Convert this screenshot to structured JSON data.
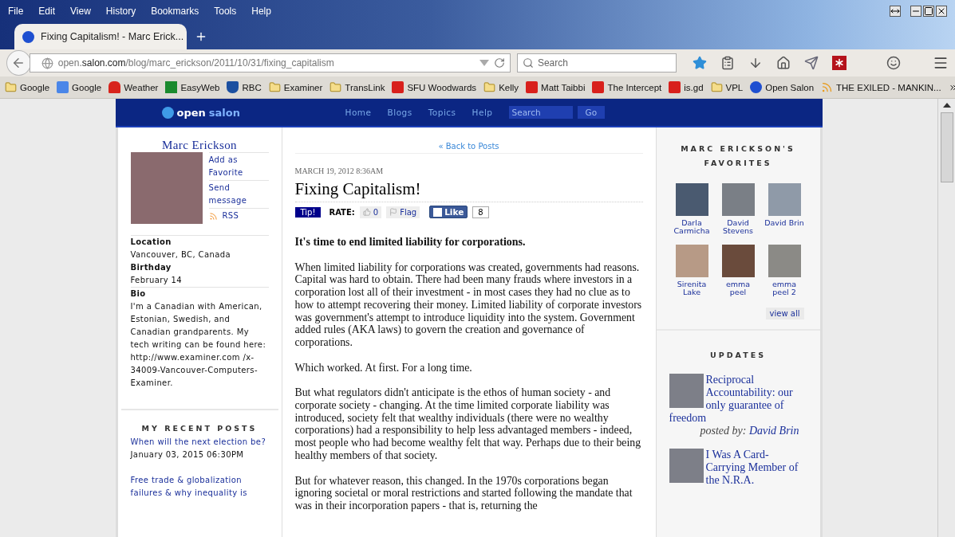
{
  "window": {
    "menu": [
      "File",
      "Edit",
      "View",
      "History",
      "Bookmarks",
      "Tools",
      "Help"
    ]
  },
  "tabs": [
    {
      "title": "Fixing Capitalism! - Marc Erick...",
      "selected": true
    }
  ],
  "address_bar": {
    "host_prefix": "open.",
    "host": "salon.com",
    "path": "/blog/marc_erickson/2011/10/31/fixing_capitalism"
  },
  "search": {
    "placeholder": "Search"
  },
  "bookmarks": [
    {
      "label": "Google",
      "kind": "folder"
    },
    {
      "label": "Google",
      "kind": "google"
    },
    {
      "label": "Weather",
      "kind": "leaf"
    },
    {
      "label": "EasyWeb",
      "kind": "green"
    },
    {
      "label": "RBC",
      "kind": "shield"
    },
    {
      "label": "Examiner",
      "kind": "folder"
    },
    {
      "label": "TransLink",
      "kind": "folder"
    },
    {
      "label": "SFU Woodwards",
      "kind": "red"
    },
    {
      "label": "Kelly",
      "kind": "folder"
    },
    {
      "label": "Matt Taibbi",
      "kind": "red"
    },
    {
      "label": "The Intercept",
      "kind": "red"
    },
    {
      "label": "is.gd",
      "kind": "red"
    },
    {
      "label": "VPL",
      "kind": "folder"
    },
    {
      "label": "Open Salon",
      "kind": "salon"
    },
    {
      "label": "THE EXILED - MANKIN...",
      "kind": "rss"
    }
  ],
  "site": {
    "logo_first": "open",
    "logo_second": "salon",
    "nav": [
      "Home",
      "Blogs",
      "Topics",
      "Help"
    ],
    "search_placeholder": "Search",
    "go": "Go"
  },
  "profile": {
    "name": "Marc Erickson",
    "links": [
      "Add as Favorite",
      "Send message"
    ],
    "rss": "RSS",
    "fields": [
      {
        "label": "Location",
        "value": "Vancouver, BC, Canada"
      },
      {
        "label": "Birthday",
        "value": "February 14"
      },
      {
        "label": "Bio",
        "value": "I'm a Canadian with American, Estonian, Swedish, and Canadian grandparents. My tech writing can be found here: http://www.examiner.com /x-34009-Vancouver-Computers-Examiner."
      }
    ]
  },
  "recent_posts": {
    "title": "MY RECENT POSTS",
    "items": [
      {
        "title": "When will the next election be?",
        "date": "January 03, 2015 06:30PM"
      },
      {
        "title": "Free trade & globalization failures & why inequality is"
      }
    ]
  },
  "article": {
    "back": "« Back to Posts",
    "date": "MARCH 19, 2012 8:36AM",
    "title": "Fixing Capitalism!",
    "tip": "Tip!",
    "rate_label": "RATE:",
    "rate_count": "0",
    "flag": "Flag",
    "like": "Like",
    "like_count": "8",
    "lead": "It's time to end limited liability for corporations.",
    "paragraphs": [
      "When limited liability for corporations was created, governments had reasons.  Capital was hard to obtain.  There had been many frauds where investors in a corporation lost all of their investment - in most cases they had no clue as to how to attempt recovering their money.  Limited liability of corporate investors was government's attempt to introduce liquidity into the system.  Government added rules (AKA laws) to govern the creation and governance of corporations.",
      "Which  worked.  At first.  For a long time.",
      "But what regulators didn't anticipate is the ethos of human society - and corporate society - changing.  At the time limited corporate liability was introduced, society felt that wealthy individuals (there were no wealthy corporations) had a responsibility to help less advantaged members - indeed, most people who had become wealthy felt that way.  Perhaps due to their being healthy members of that society.",
      "But for whatever reason, this changed.  In the 1970s corporations began ignoring societal or moral restrictions and started following the mandate that was in their incorporation papers - that is, returning the"
    ]
  },
  "favorites": {
    "title": "MARC ERICKSON'S FAVORITES",
    "people": [
      {
        "name": "Darla Carmicha"
      },
      {
        "name": "David Stevens"
      },
      {
        "name": "David Brin"
      },
      {
        "name": "Sirenita Lake"
      },
      {
        "name": "emma peel"
      },
      {
        "name": "emma peel 2"
      }
    ],
    "view_all": "view all"
  },
  "updates": {
    "title": "UPDATES",
    "items": [
      {
        "title": "Reciprocal Accountability: our only guarantee of freedom",
        "posted_label": "posted by:",
        "author": "David Brin"
      },
      {
        "title": "I Was A Card-Carrying Member of the N.R.A."
      }
    ]
  }
}
